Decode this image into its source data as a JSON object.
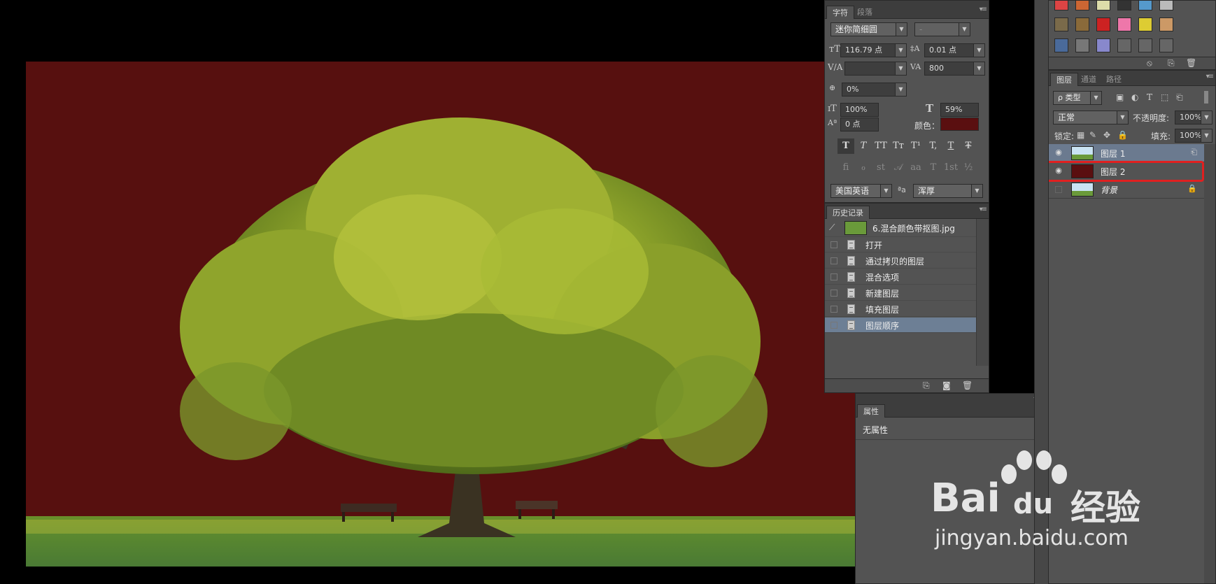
{
  "character_panel": {
    "tabs": [
      "字符",
      "段落"
    ],
    "font_family": "迷你简细圆",
    "font_style": "-",
    "font_size": "116.79 点",
    "leading": "0.01 点",
    "kerning": "",
    "tracking": "800",
    "scale_percent": "0%",
    "vertical_scale": "100%",
    "horizontal_scale": "59%",
    "baseline_shift": "0 点",
    "color_label": "颜色：",
    "color_value": "#5a0f10",
    "language": "美国英语",
    "aa_label": "ªa",
    "antialias": "浑厚",
    "style_buttons": [
      "T",
      "T",
      "TT",
      "Tт",
      "T¹",
      "T,",
      "T",
      "Ŧ"
    ],
    "ot_buttons": [
      "ﬁ",
      "ℴ",
      "st",
      "𝒜",
      "aa",
      "T",
      "1st",
      "½"
    ]
  },
  "history_panel": {
    "title": "历史记录",
    "snapshot": "6.混合颜色带抠图.jpg",
    "items": [
      "打开",
      "通过拷贝的图层",
      "混合选项",
      "新建图层",
      "填充图层",
      "图层顺序"
    ]
  },
  "properties_panel": {
    "title": "属性",
    "text": "无属性"
  },
  "layers_panel": {
    "tabs": [
      "图层",
      "通道",
      "路径"
    ],
    "filter_kind": "ρ 类型",
    "blend_mode": "正常",
    "opacity_label": "不透明度:",
    "opacity": "100%",
    "lock_label": "锁定:",
    "fill_label": "填充:",
    "fill": "100%",
    "layers": [
      {
        "name": "图层 1",
        "selected": true
      },
      {
        "name": "图层 2",
        "selected": false
      },
      {
        "name": "背景",
        "selected": false
      }
    ]
  },
  "watermark": {
    "brand": "Bai",
    "brand_du": "du",
    "brand_cn": "经验",
    "url": "jingyan.baidu.com"
  },
  "colors": {
    "canvas_bg": "#57100f",
    "panel": "#535353",
    "selection": "#6b7a8f",
    "highlight_box": "#e02020"
  }
}
